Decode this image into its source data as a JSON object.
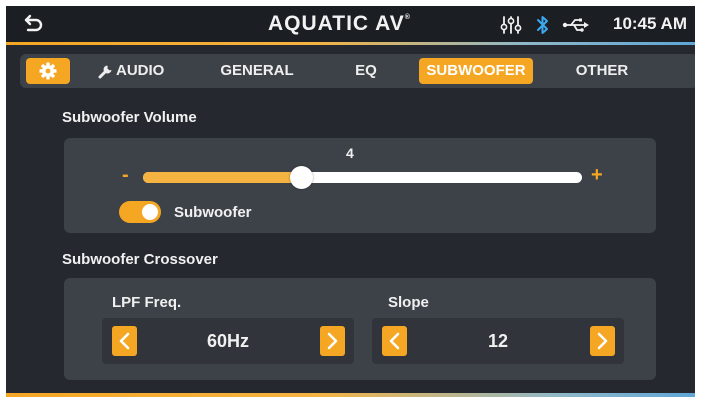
{
  "status_bar": {
    "brand": "AQUATIC AV",
    "brand_mark": "®",
    "time": "10:45 AM",
    "icons": [
      "back-icon",
      "equalizer-sliders-icon",
      "bluetooth-icon",
      "usb-icon"
    ]
  },
  "tabs": {
    "settings_icon": "gear-icon",
    "items": [
      {
        "label": "AUDIO",
        "icon": "wrench-icon"
      },
      {
        "label": "GENERAL"
      },
      {
        "label": "EQ"
      },
      {
        "label": "SUBWOOFER"
      },
      {
        "label": "OTHER"
      }
    ],
    "active": "SUBWOOFER"
  },
  "volume": {
    "title": "Subwoofer Volume",
    "value": "4",
    "minus_label": "-",
    "plus_label": "+",
    "level_fraction": 0.36
  },
  "toggle": {
    "label": "Subwoofer",
    "state": "on"
  },
  "crossover": {
    "title": "Subwoofer Crossover",
    "lpf_label": "LPF Freq.",
    "lpf_value": "60Hz",
    "slope_label": "Slope",
    "slope_value": "12"
  },
  "colors": {
    "accent": "#f5a623",
    "background": "#25292f",
    "panel": "#3d4248"
  }
}
